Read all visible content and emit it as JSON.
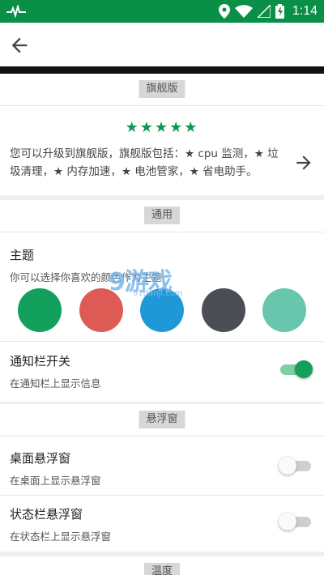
{
  "status_bar": {
    "time": "1:14",
    "icons": [
      "pulse-icon",
      "location-icon",
      "wifi-icon",
      "signal-icon",
      "battery-charging-icon"
    ],
    "color": "#0a8f47"
  },
  "app_bar": {
    "back_icon": "arrow-back-icon"
  },
  "flagship": {
    "header": "旗舰版",
    "stars": "★★★★★",
    "description": "您可以升级到旗舰版，旗舰版包括：★ cpu 监测，★ 垃圾清理，★ 内存加速，★ 电池管家，★ 省电助手。",
    "arrow_icon": "arrow-forward-icon"
  },
  "general": {
    "header": "通用",
    "theme_title": "主题",
    "theme_subtitle": "你可以选择你喜欢的颜色作为主题",
    "theme_colors": [
      "#13a05d",
      "#de5b55",
      "#1e98d7",
      "#4b4f55",
      "#68c6ac"
    ],
    "notification_title": "通知栏开关",
    "notification_subtitle": "在通知栏上显示信息",
    "notification_on": true
  },
  "floating": {
    "header": "悬浮窗",
    "desktop_title": "桌面悬浮窗",
    "desktop_subtitle": "在桌面上显示悬浮窗",
    "desktop_on": false,
    "statusbar_title": "状态栏悬浮窗",
    "statusbar_subtitle": "在状态栏上显示悬浮窗",
    "statusbar_on": false
  },
  "temperature": {
    "header": "温度"
  },
  "watermark": {
    "brand": "9游戏",
    "url": "91danji.com"
  },
  "accent_color": "#0a9a4f"
}
